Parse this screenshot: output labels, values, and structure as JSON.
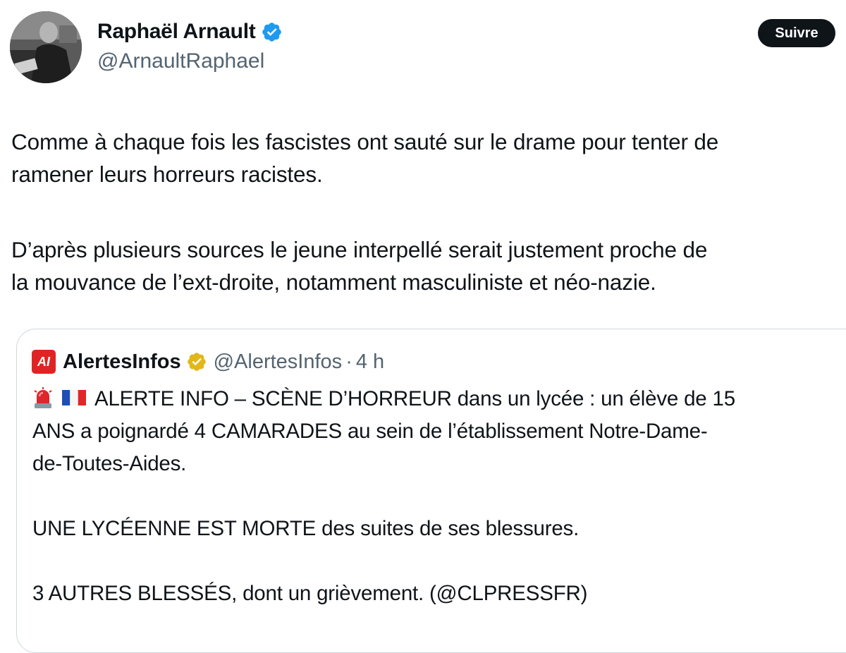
{
  "author": {
    "display_name": "Raphaël Arnault",
    "handle": "@ArnaultRaphael",
    "avatar_icon": "profile-photo",
    "verified_icon": "verified-badge-icon",
    "verified_color": "#1d9bf0"
  },
  "follow_button": {
    "label": "Suivre"
  },
  "tweet": {
    "paragraph1_line1": "Comme à chaque fois les fascistes ont sauté sur le drame pour tenter de",
    "paragraph1_line2": "ramener leurs horreurs racistes.",
    "paragraph2_line1": "D’après plusieurs sources le jeune interpellé serait justement proche de",
    "paragraph2_line2": "la mouvance de l’ext-droite, notamment masculiniste et néo-nazie."
  },
  "quoted_tweet": {
    "logo_text": "AI",
    "logo_color": "#e02424",
    "display_name": "AlertesInfos",
    "badge_icon": "gold-verified-badge-icon",
    "badge_color": "#e2b719",
    "handle": "@AlertesInfos",
    "separator": "·",
    "time": "4 h",
    "emoji_siren": "siren-icon",
    "emoji_flag": "france-flag-icon",
    "line1": "ALERTE INFO – SCÈNE D’HORREUR dans un lycée : un élève de 15",
    "line2": "ANS a poignardé 4 CAMARADES au sein de l’établissement Notre-Dame-",
    "line3": "de-Toutes-Aides.",
    "line4": "UNE LYCÉENNE EST MORTE des suites de ses blessures.",
    "line5": "3 AUTRES BLESSÉS, dont un grièvement. (@CLPRESSFR)"
  }
}
